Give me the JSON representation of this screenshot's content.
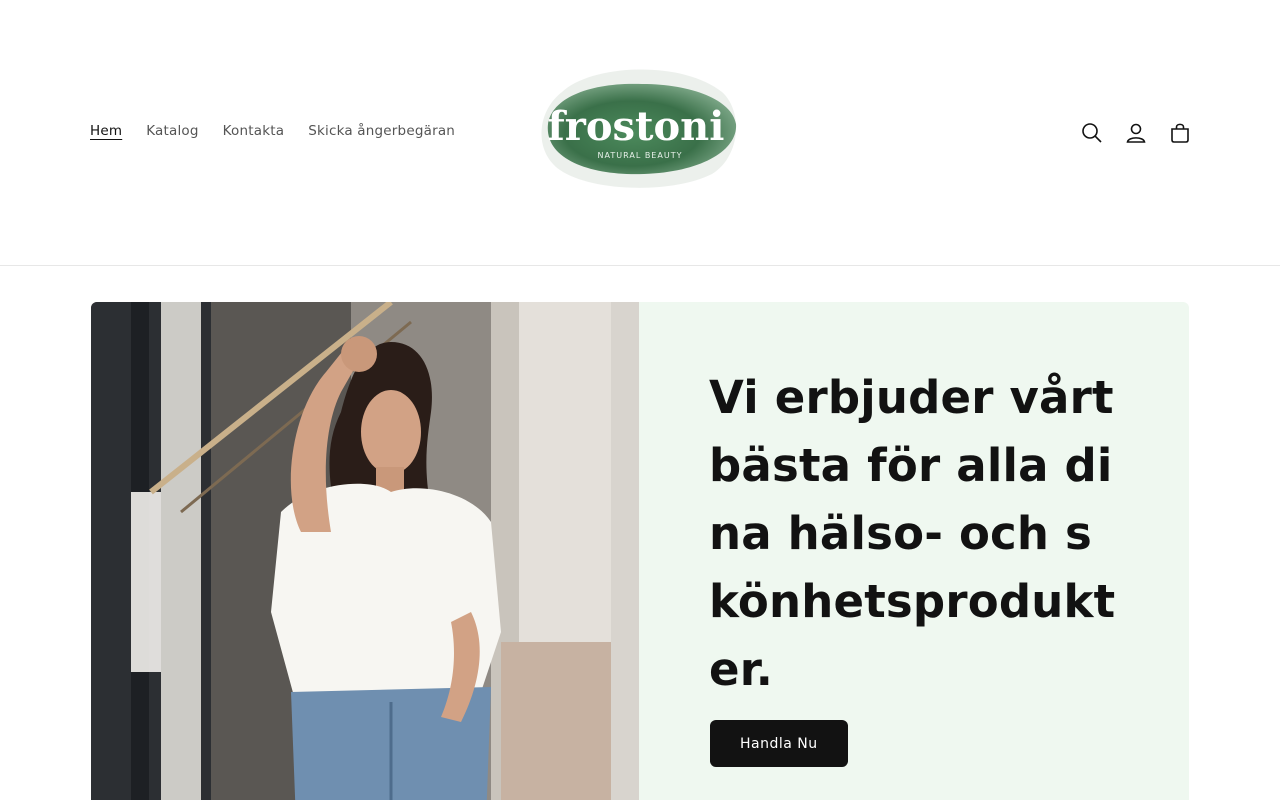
{
  "nav": {
    "items": [
      {
        "label": "Hem",
        "active": true
      },
      {
        "label": "Katalog",
        "active": false
      },
      {
        "label": "Kontakta",
        "active": false
      },
      {
        "label": "Skicka ångerbegäran",
        "active": false
      }
    ]
  },
  "logo": {
    "brand": "frostoni",
    "tagline": "NATURAL BEAUTY",
    "color": "#3f7a4f"
  },
  "header_icons": [
    "search-icon",
    "account-icon",
    "cart-icon"
  ],
  "hero": {
    "heading": "Vi erbjuder vårt bästa för alla dina hälso- och skönhetsprodukter.",
    "button_label": "Handla Nu",
    "text_panel_color": "#eff8f0",
    "button_color": "#121212"
  }
}
